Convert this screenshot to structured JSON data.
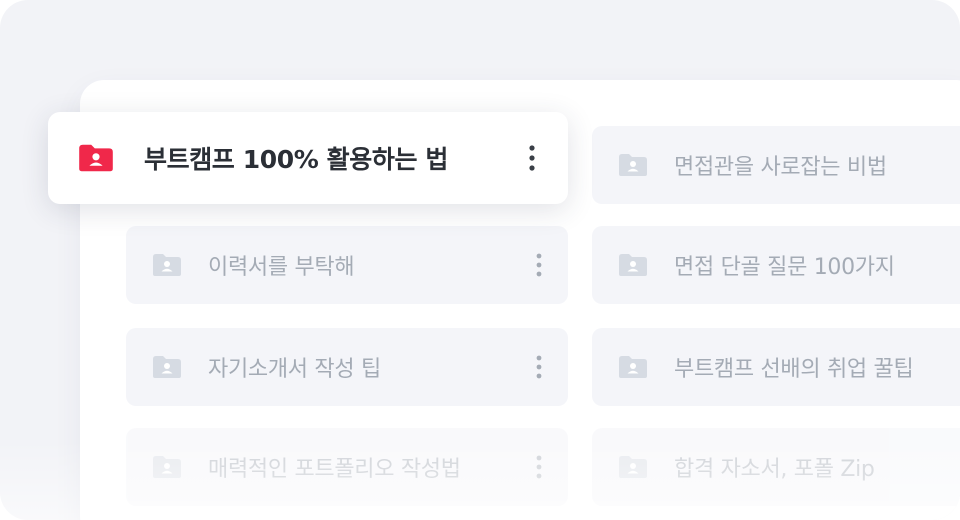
{
  "colors": {
    "accent_folder": "#f0284a",
    "muted_folder": "#d6dbe3",
    "card_bg": "#f4f5f9",
    "muted_text": "#a4abb5",
    "dark_text": "#2b2f36"
  },
  "featured_folder": {
    "label": "부트캠프 100% 활용하는 법",
    "icon": "folder-user-icon",
    "menu_icon": "kebab-menu-icon"
  },
  "folders": [
    {
      "label": "면접관을 사로잡는 비법",
      "icon": "folder-user-icon"
    },
    {
      "label": "이력서를 부탁해",
      "icon": "folder-user-icon",
      "menu_icon": "kebab-menu-icon"
    },
    {
      "label": "면접 단골 질문 100가지",
      "icon": "folder-user-icon"
    },
    {
      "label": "자기소개서 작성 팁",
      "icon": "folder-user-icon",
      "menu_icon": "kebab-menu-icon"
    },
    {
      "label": "부트캠프 선배의 취업 꿀팁",
      "icon": "folder-user-icon"
    },
    {
      "label": "매력적인 포트폴리오 작성법",
      "icon": "folder-user-icon",
      "menu_icon": "kebab-menu-icon"
    },
    {
      "label": "합격 자소서, 포폴 Zip",
      "icon": "folder-user-icon"
    }
  ]
}
